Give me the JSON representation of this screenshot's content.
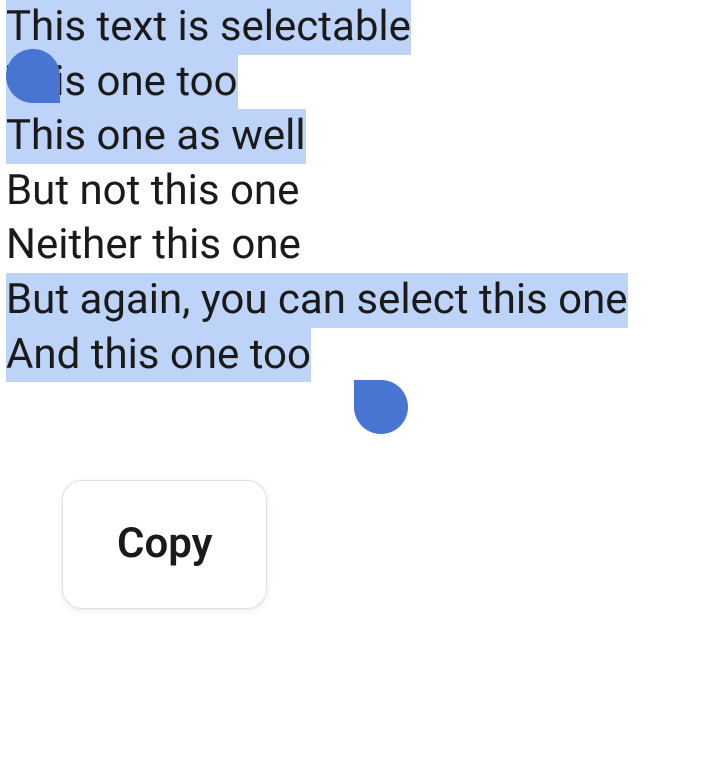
{
  "lines": [
    {
      "text": "This text is selectable",
      "highlighted": true
    },
    {
      "text": "This one too",
      "highlighted": true
    },
    {
      "text": "This one as well",
      "highlighted": true
    },
    {
      "text": "But not this one",
      "highlighted": false
    },
    {
      "text": "Neither this one",
      "highlighted": false
    },
    {
      "text": "But again, you can select this one",
      "highlighted": true
    },
    {
      "text": "And this one too",
      "highlighted": true
    }
  ],
  "popup": {
    "copy_label": "Copy"
  }
}
